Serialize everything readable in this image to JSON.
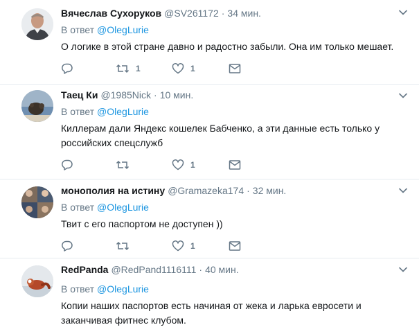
{
  "reply_prefix": "В ответ",
  "tweets": [
    {
      "name": "Вячеслав Сухоруков",
      "handle": "@SV261172",
      "time": "34 мин.",
      "reply_to": "@OlegLurie",
      "text": "О логике в этой стране давно и радостно забыли. Она им только мешает.",
      "retweets": "1",
      "likes": "1"
    },
    {
      "name": "Таец Ки",
      "handle": "@1985Nick",
      "time": "10 мин.",
      "reply_to": "@OlegLurie",
      "text": "Киллерам дали Яндекс кошелек Бабченко, а эти данные есть только у российских спецслужб",
      "retweets": "",
      "likes": "1"
    },
    {
      "name": "монополия на истину",
      "handle": "@Gramazeka174",
      "time": "32 мин.",
      "reply_to": "@OlegLurie",
      "text": "Твит с его паспортом не доступен ))",
      "retweets": "",
      "likes": "1"
    },
    {
      "name": "RedPanda",
      "handle": "@RedPand1116111",
      "time": "40 мин.",
      "reply_to": "@OlegLurie",
      "text": "Копии наших паспортов есть начиная от жека и ларька евросети и заканчивая фитнес клубом.",
      "retweets": "",
      "likes": ""
    }
  ],
  "colors": {
    "text": "#14171a",
    "secondary": "#657786",
    "link": "#1b95e0",
    "divider": "#e6ecf0"
  }
}
